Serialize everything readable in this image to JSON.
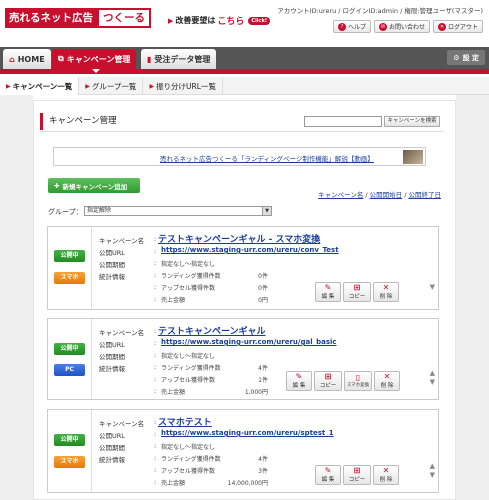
{
  "header": {
    "logo_left": "売れるネット広告",
    "logo_right": "つくーる",
    "request_prefix": "改善要望は",
    "request_highlight": "こちら",
    "request_click": "Click!",
    "account": "アカウントID:ureru / ログインID:admin / 権限:管理ユーザ(マスター)",
    "buttons": {
      "help": "ヘルプ",
      "contact": "お問い合わせ",
      "logout": "ログアウト"
    }
  },
  "nav": {
    "home": "HOME",
    "campaign": "キャンペーン管理",
    "order": "受注データ管理",
    "settings": "設 定"
  },
  "subnav": {
    "items": [
      "キャンペーン一覧",
      "グループ一覧",
      "振り分けURL一覧"
    ]
  },
  "page": {
    "title": "キャンペーン管理",
    "search_button": "キャンペーンを検索",
    "banner_text": "売れるネット広告つくーる「ランディングページ制作機能」解説【動画】",
    "new_button": "新規キャンペーン追加",
    "sort_links": [
      "キャンペーン名",
      "公開開始日",
      "公開終了日"
    ],
    "group_label": "グループ：",
    "group_value": "指定解除"
  },
  "labels": {
    "name": "キャンペーン名",
    "url": "公開URL",
    "period": "公開期間",
    "stats": "統計情報",
    "landing": "ランディング獲得件数",
    "upsell": "アップセル獲得件数",
    "sales": "売上金額"
  },
  "actions": {
    "edit": "編 集",
    "copy": "コピー",
    "delete": "削 除",
    "sp": "スマホ変換"
  },
  "campaigns": [
    {
      "status": "公開中",
      "device": "スマホ",
      "name": "テストキャンペーンギャル - スマホ変換",
      "url": "https://www.staging-urr.com/ureru/conv_Test",
      "period": "指定なし〜指定なし",
      "landing": "0件",
      "upsell": "0件",
      "sales": "0円"
    },
    {
      "status": "公開中",
      "device": "PC",
      "name": "テストキャンペーンギャル",
      "url": "https://www.staging-urr.com/ureru/gal_basic",
      "period": "指定なし〜指定なし",
      "landing": "4件",
      "upsell": "1件",
      "sales": "1,000円"
    },
    {
      "status": "公開中",
      "device": "スマホ",
      "name": "スマホテスト",
      "url": "https://www.staging-urr.com/ureru/sptest_1",
      "period": "指定なし〜指定なし",
      "landing": "4件",
      "upsell": "3件",
      "sales": "14,000,000円"
    }
  ],
  "colors": {
    "brand_red": "#c8102e",
    "link_blue": "#1a3e9c",
    "status_green": "#2f9a2f",
    "device_orange": "#e07c0c",
    "device_blue": "#1e54c9"
  }
}
